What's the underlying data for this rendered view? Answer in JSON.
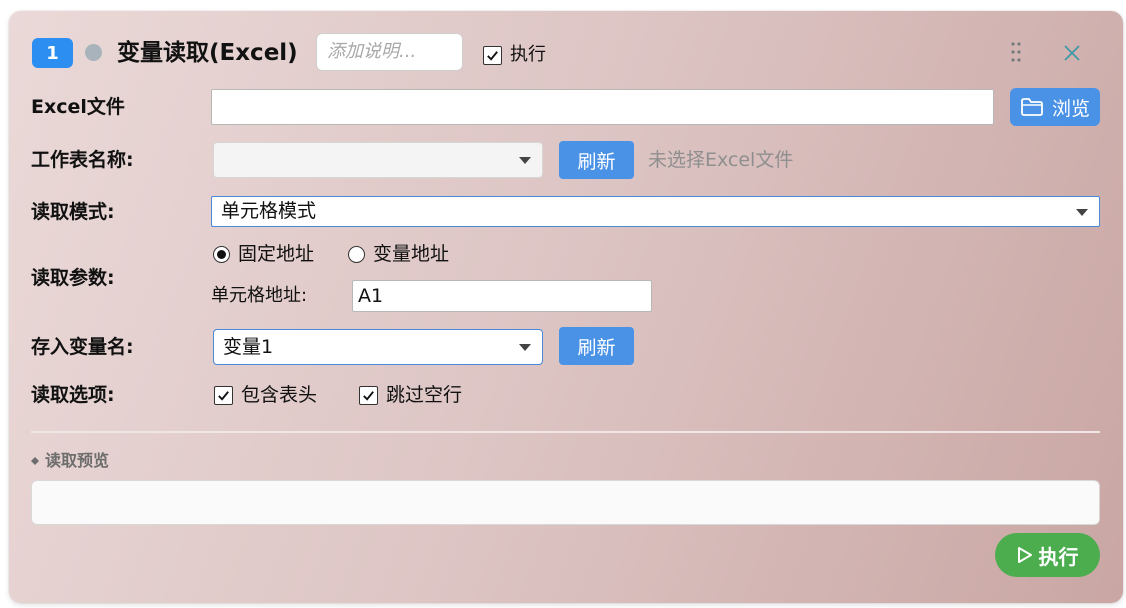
{
  "header": {
    "step_number": "1",
    "title": "变量读取(Excel)",
    "note_placeholder": "添加说明...",
    "execute_label": "执行",
    "execute_checked": true
  },
  "form": {
    "excel_file": {
      "label": "Excel文件",
      "value": "",
      "browse_label": "浏览"
    },
    "sheet": {
      "label": "工作表名称:",
      "value": "",
      "refresh_label": "刷新",
      "hint": "未选择Excel文件"
    },
    "read_mode": {
      "label": "读取模式:",
      "value": "单元格模式"
    },
    "read_params": {
      "label": "读取参数:",
      "options": [
        {
          "label": "固定地址",
          "selected": true
        },
        {
          "label": "变量地址",
          "selected": false
        }
      ],
      "cell_address_label": "单元格地址:",
      "cell_address_value": "A1"
    },
    "save_var": {
      "label": "存入变量名:",
      "value": "变量1",
      "refresh_label": "刷新"
    },
    "read_options": {
      "label": "读取选项:",
      "items": [
        {
          "label": "包含表头",
          "checked": true
        },
        {
          "label": "跳过空行",
          "checked": true
        }
      ]
    }
  },
  "preview": {
    "label": "读取预览",
    "value": ""
  },
  "footer": {
    "run_label": "执行"
  },
  "colors": {
    "accent": "#2c8ef0",
    "button_blue": "#4a92e6",
    "run_green": "#4cad4e",
    "status_dot": "#a9b3bb"
  },
  "icons": [
    "drag-handle-icon",
    "close-icon",
    "folder-icon",
    "play-icon",
    "chevron-down-icon",
    "check-icon"
  ]
}
